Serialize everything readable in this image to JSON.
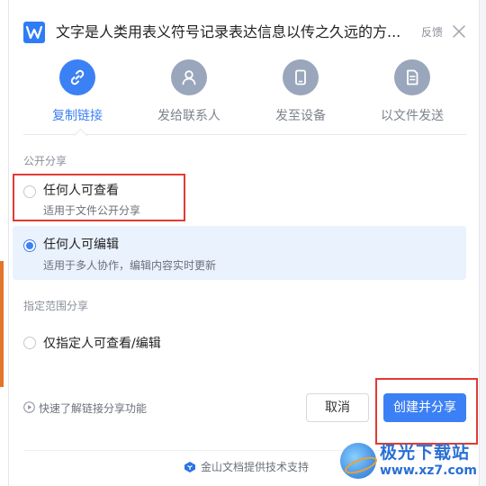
{
  "dialog": {
    "title": "文字是人类用表义符号记录表达信息以传之久远的方...",
    "feedback_label": "反馈"
  },
  "share_methods": [
    {
      "label": "复制链接",
      "icon": "link-icon",
      "active": true
    },
    {
      "label": "发给联系人",
      "icon": "person-icon",
      "active": false
    },
    {
      "label": "发至设备",
      "icon": "tablet-icon",
      "active": false
    },
    {
      "label": "以文件发送",
      "icon": "file-icon",
      "active": false
    }
  ],
  "public_share": {
    "section_label": "公开分享",
    "options": [
      {
        "title": "任何人可查看",
        "desc": "适用于文件公开分享",
        "checked": false
      },
      {
        "title": "任何人可编辑",
        "desc": "适用于多人协作，编辑内容实时更新",
        "checked": true
      }
    ]
  },
  "scoped_share": {
    "section_label": "指定范围分享",
    "options": [
      {
        "title": "仅指定人可查看/编辑",
        "checked": false
      }
    ]
  },
  "help_link": "快速了解链接分享功能",
  "buttons": {
    "cancel": "取消",
    "create_share": "创建并分享"
  },
  "footer_text": "金山文档提供技术支持",
  "watermark": {
    "title": "极光下载站",
    "url": "www.xz7.com"
  },
  "colors": {
    "accent": "#3c80f5",
    "highlight_box": "#e23a35",
    "selected_bg": "#eaf2fe"
  }
}
